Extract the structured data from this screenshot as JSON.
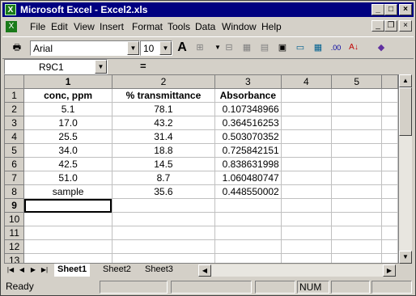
{
  "window": {
    "title": "Microsoft Excel - Excel2.xls",
    "app_icon": "excel-icon",
    "controls": [
      "_",
      "□",
      "×"
    ]
  },
  "menu": [
    "File",
    "Edit",
    "View",
    "Insert",
    "Format",
    "Tools",
    "Data",
    "Window",
    "Help"
  ],
  "toolbar": {
    "font_name": "Arial",
    "font_size": "10"
  },
  "formula_bar": {
    "name_box": "R9C1",
    "equals": "=",
    "content": ""
  },
  "sheet": {
    "column_headers": [
      "1",
      "2",
      "3",
      "4",
      "5"
    ],
    "row_headers": [
      "1",
      "2",
      "3",
      "4",
      "5",
      "6",
      "7",
      "8",
      "9",
      "10",
      "11",
      "12",
      "13"
    ],
    "rows": [
      [
        "conc, ppm",
        "% transmittance",
        "Absorbance",
        "",
        ""
      ],
      [
        "5.1",
        "78.1",
        "0.107348966",
        "",
        ""
      ],
      [
        "17.0",
        "43.2",
        "0.364516253",
        "",
        ""
      ],
      [
        "25.5",
        "31.4",
        "0.503070352",
        "",
        ""
      ],
      [
        "34.0",
        "18.8",
        "0.725842151",
        "",
        ""
      ],
      [
        "42.5",
        "14.5",
        "0.838631998",
        "",
        ""
      ],
      [
        "51.0",
        "8.7",
        "1.060480747",
        "",
        ""
      ],
      [
        "sample",
        "35.6",
        "0.448550002",
        "",
        ""
      ],
      [
        "",
        "",
        "",
        "",
        ""
      ],
      [
        "",
        "",
        "",
        "",
        ""
      ],
      [
        "",
        "",
        "",
        "",
        ""
      ],
      [
        "",
        "",
        "",
        "",
        ""
      ],
      [
        "",
        "",
        "",
        "",
        ""
      ]
    ]
  },
  "tabs": [
    "Sheet1",
    "Sheet2",
    "Sheet3"
  ],
  "status": {
    "mode": "Ready",
    "num": "NUM"
  }
}
